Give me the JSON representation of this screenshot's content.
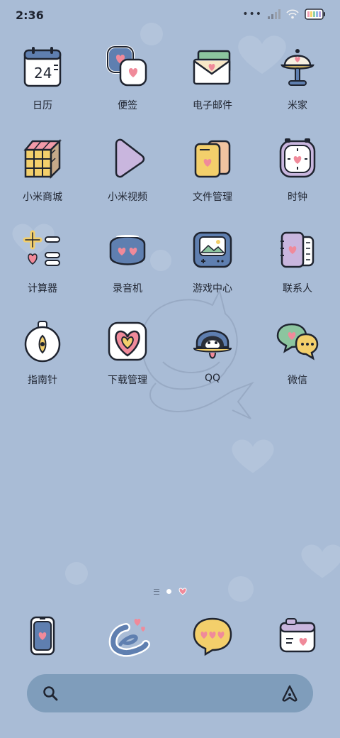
{
  "status_bar": {
    "time": "2:36"
  },
  "apps": [
    [
      {
        "label": "日历",
        "icon": "calendar-icon",
        "day": "24"
      },
      {
        "label": "便签",
        "icon": "notes-icon"
      },
      {
        "label": "电子邮件",
        "icon": "mail-icon"
      },
      {
        "label": "米家",
        "icon": "lamp-icon"
      }
    ],
    [
      {
        "label": "小米商城",
        "icon": "cube-icon"
      },
      {
        "label": "小米视频",
        "icon": "play-icon"
      },
      {
        "label": "文件管理",
        "icon": "folder-icon"
      },
      {
        "label": "时钟",
        "icon": "clock-icon"
      }
    ],
    [
      {
        "label": "计算器",
        "icon": "calculator-icon"
      },
      {
        "label": "录音机",
        "icon": "recorder-icon"
      },
      {
        "label": "游戏中心",
        "icon": "game-icon"
      },
      {
        "label": "联系人",
        "icon": "contacts-icon"
      }
    ],
    [
      {
        "label": "指南针",
        "icon": "compass-icon"
      },
      {
        "label": "下载管理",
        "icon": "download-icon"
      },
      {
        "label": "QQ",
        "icon": "penguin-icon"
      },
      {
        "label": "微信",
        "icon": "chat-icon"
      }
    ]
  ],
  "dock": [
    {
      "icon": "phone-icon"
    },
    {
      "icon": "browser-icon"
    },
    {
      "icon": "message-icon"
    },
    {
      "icon": "camera-icon"
    }
  ],
  "colors": {
    "background": "#a9bcd6",
    "search_bar": "#7f9dbb",
    "heart": "#f08a9a"
  }
}
